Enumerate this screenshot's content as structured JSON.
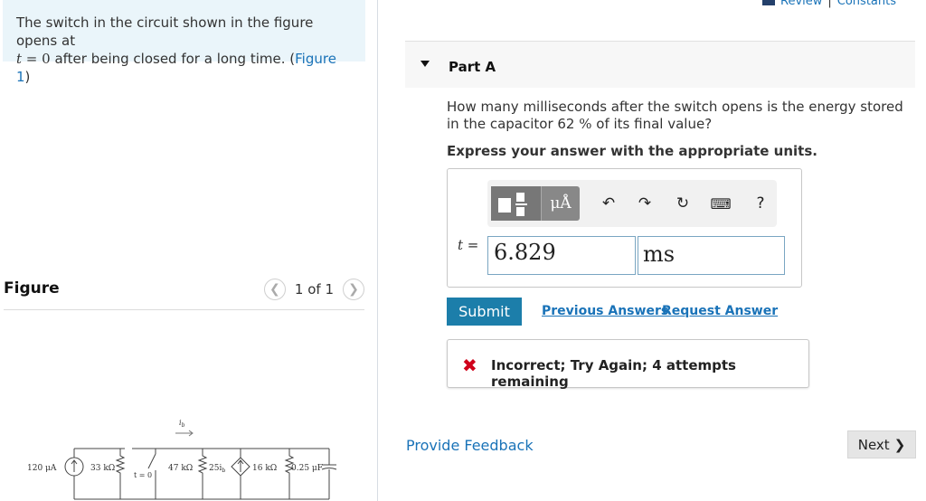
{
  "problem": {
    "text_before": "The switch in the circuit shown in the figure opens at",
    "t_var": "t",
    "t_rest": " = 0",
    "text_after": " after being closed for a long time. (",
    "figure_link": "Figure 1",
    "text_close": ")"
  },
  "figure": {
    "title": "Figure",
    "page_text": "1 of 1",
    "prev_icon": "chevron-left-icon",
    "next_icon": "chevron-right-icon",
    "circuit": {
      "source_label": "120 μA",
      "r1_label": "33 kΩ",
      "current_label": "i",
      "current_sub": "b",
      "switch_label": "t = 0",
      "r2_label": "47 kΩ",
      "dep_label": "25i",
      "dep_sub": "b",
      "r3_label": "16 kΩ",
      "cap_label": "0.25 μF"
    }
  },
  "header": {
    "review": "Review",
    "separator": "|",
    "constants": "Constants"
  },
  "part": {
    "label": "Part A"
  },
  "question": {
    "text1": "How many milliseconds after the switch opens is the energy stored in the capacitor 62 ",
    "percent": "%",
    "text2": " of its final value?",
    "instructions": "Express your answer with the appropriate units."
  },
  "answer": {
    "toolbar": {
      "template_icon": "fraction-template-icon",
      "units_label": "μÅ",
      "undo_icon": "undo-icon",
      "redo_icon": "redo-icon",
      "reset_icon": "reset-icon",
      "keyboard_icon": "keyboard-icon",
      "help_label": "?"
    },
    "variable": "t",
    "equals": " =",
    "value": "6.829",
    "unit": "ms"
  },
  "actions": {
    "submit": "Submit",
    "previous_answers": "Previous Answers",
    "request_answer": "Request Answer"
  },
  "feedback": {
    "icon": "x-mark-icon",
    "text": "Incorrect; Try Again; 4 attempts remaining"
  },
  "footer": {
    "provide_feedback": "Provide Feedback",
    "next": "Next"
  },
  "colors": {
    "link": "#1a73b8",
    "submit_bg": "#1c7eaa",
    "error": "#d0021b",
    "problem_bg": "#eaf5fa"
  }
}
